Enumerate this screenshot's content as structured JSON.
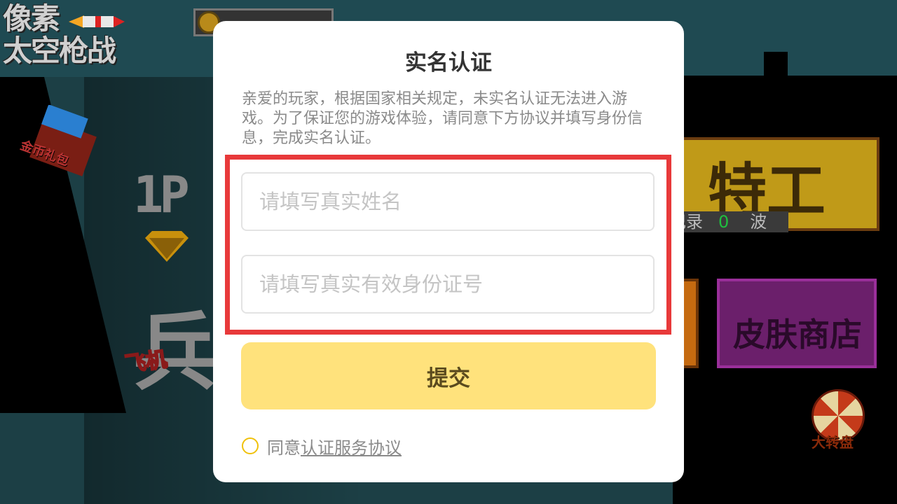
{
  "game": {
    "title_line1": "像素",
    "title_line2": "太空枪战",
    "gift_label": "金币礼包",
    "player_label": "1P",
    "mode_glyph": "兵",
    "mode_scribble": "飞机",
    "agent_button_label": "特工",
    "record_label": "记录",
    "record_value": "0",
    "record_unit": "波",
    "skin_shop_label": "皮肤商店",
    "wheel_label": "大转盘"
  },
  "dialog": {
    "title": "实名认证",
    "description": "亲爱的玩家，根据国家相关规定，未实名认证无法进入游戏。为了保证您的游戏体验，请同意下方协议并填写身份信息，完成实名认证。",
    "name_input": {
      "value": "",
      "placeholder": "请填写真实姓名"
    },
    "id_input": {
      "value": "",
      "placeholder": "请填写真实有效身份证号"
    },
    "submit_label": "提交",
    "agree_prefix": "同意",
    "agreement_link": "认证服务协议"
  },
  "colors": {
    "highlight_border": "#e8393a",
    "submit_bg": "#ffe27c",
    "radio_border": "#f0c10a",
    "dialog_bg": "#ffffff"
  }
}
